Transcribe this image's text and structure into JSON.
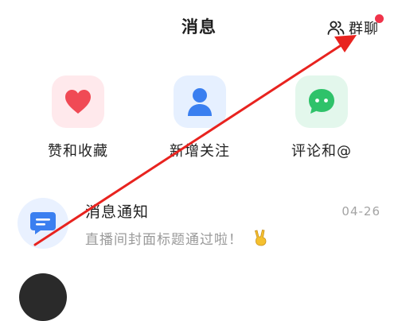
{
  "header": {
    "title": "消息",
    "group_chat_label": "群聊",
    "group_chat_icon": "group-people-icon",
    "badge_color": "#f0334a"
  },
  "shortcuts": [
    {
      "label": "赞和收藏",
      "icon": "heart-icon",
      "color": "#f04a55"
    },
    {
      "label": "新增关注",
      "icon": "person-icon",
      "color": "#3a7ff0"
    },
    {
      "label": "评论和@",
      "icon": "chat-bubble-icon",
      "color": "#2fc26a"
    }
  ],
  "messages": [
    {
      "title": "消息通知",
      "preview": "直播间封面标题通过啦！",
      "date": "04-26",
      "icon": "message-notification-icon",
      "emoji": "victory-hand-emoji"
    }
  ],
  "annotation": {
    "type": "arrow",
    "color": "#e8231f",
    "points_to": "群聊"
  }
}
